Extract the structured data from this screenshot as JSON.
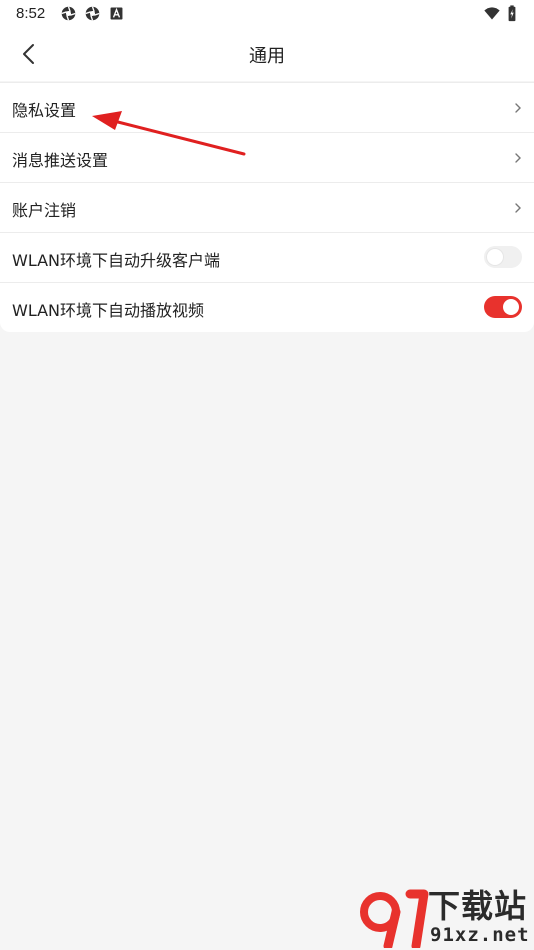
{
  "status_bar": {
    "time": "8:52",
    "left_icons": [
      "aperture-icon",
      "aperture-icon",
      "font-a-icon"
    ],
    "right_icons": [
      "wifi-icon",
      "battery-charging-icon"
    ]
  },
  "header": {
    "title": "通用",
    "back_icon": "chevron-left-icon"
  },
  "settings": {
    "items": [
      {
        "label": "隐私设置",
        "control": "chevron"
      },
      {
        "label": "消息推送设置",
        "control": "chevron"
      },
      {
        "label": "账户注销",
        "control": "chevron"
      },
      {
        "label": "WLAN环境下自动升级客户端",
        "control": "toggle",
        "enabled": false
      },
      {
        "label": "WLAN环境下自动播放视频",
        "control": "toggle",
        "enabled": true
      }
    ]
  },
  "colors": {
    "accent": "#e8322d",
    "annotation_arrow": "#e02020",
    "background": "#f5f5f5",
    "surface": "#ffffff"
  },
  "watermark": {
    "title": "下载站",
    "domain": "91xz.net"
  }
}
